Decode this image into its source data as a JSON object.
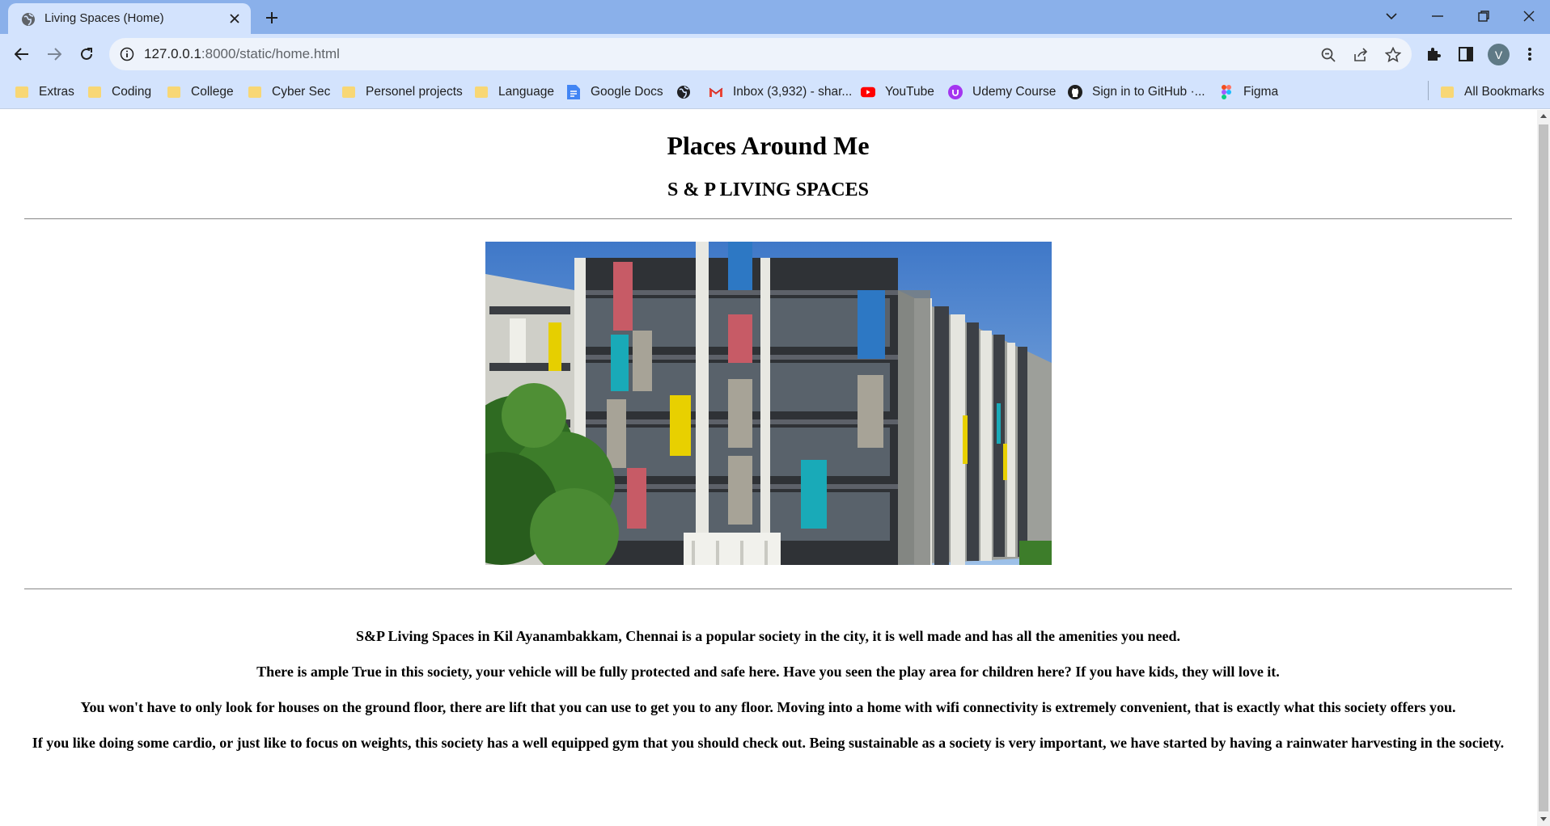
{
  "browser": {
    "tab_title": "Living Spaces (Home)",
    "url_host": "127.0.0.1",
    "url_rest": ":8000/static/home.html",
    "avatar_letter": "V",
    "accent": "#d3e3fd",
    "titlebar_color": "#8ab0ea"
  },
  "bookmarks": [
    {
      "label": "Extras",
      "icon": "folder-icon"
    },
    {
      "label": "Coding",
      "icon": "folder-icon"
    },
    {
      "label": "College",
      "icon": "folder-icon"
    },
    {
      "label": "Cyber Sec",
      "icon": "folder-icon"
    },
    {
      "label": "Personel projects",
      "icon": "folder-icon"
    },
    {
      "label": "Language",
      "icon": "folder-icon"
    },
    {
      "label": "Google Docs",
      "icon": "google-docs-icon"
    },
    {
      "label": "",
      "icon": "globe-icon"
    },
    {
      "label": "Inbox (3,932) - shar...",
      "icon": "gmail-icon"
    },
    {
      "label": "YouTube",
      "icon": "youtube-icon"
    },
    {
      "label": "Udemy Course",
      "icon": "udemy-icon"
    },
    {
      "label": "Sign in to GitHub ·...",
      "icon": "github-icon"
    },
    {
      "label": "Figma",
      "icon": "figma-icon"
    }
  ],
  "all_bookmarks": "All Bookmarks",
  "page": {
    "title": "Places Around Me",
    "subtitle": "S & P LIVING SPACES",
    "paragraphs": [
      "S&P Living Spaces in Kil Ayanambakkam, Chennai is a popular society in the city, it is well made and has all the amenities you need.",
      "There is ample True in this society, your vehicle will be fully protected and safe here. Have you seen the play area for children here? If you have kids, they will love it.",
      "You won't have to only look for houses on the ground floor, there are lift that you can use to get you to any floor. Moving into a home with wifi connectivity is extremely convenient, that is exactly what this society offers you.",
      "If you like doing some cardio, or just like to focus on weights, this society has a well equipped gym that you should check out. Being sustainable as a society is very important, we have started by having a rainwater harvesting in the society."
    ]
  }
}
